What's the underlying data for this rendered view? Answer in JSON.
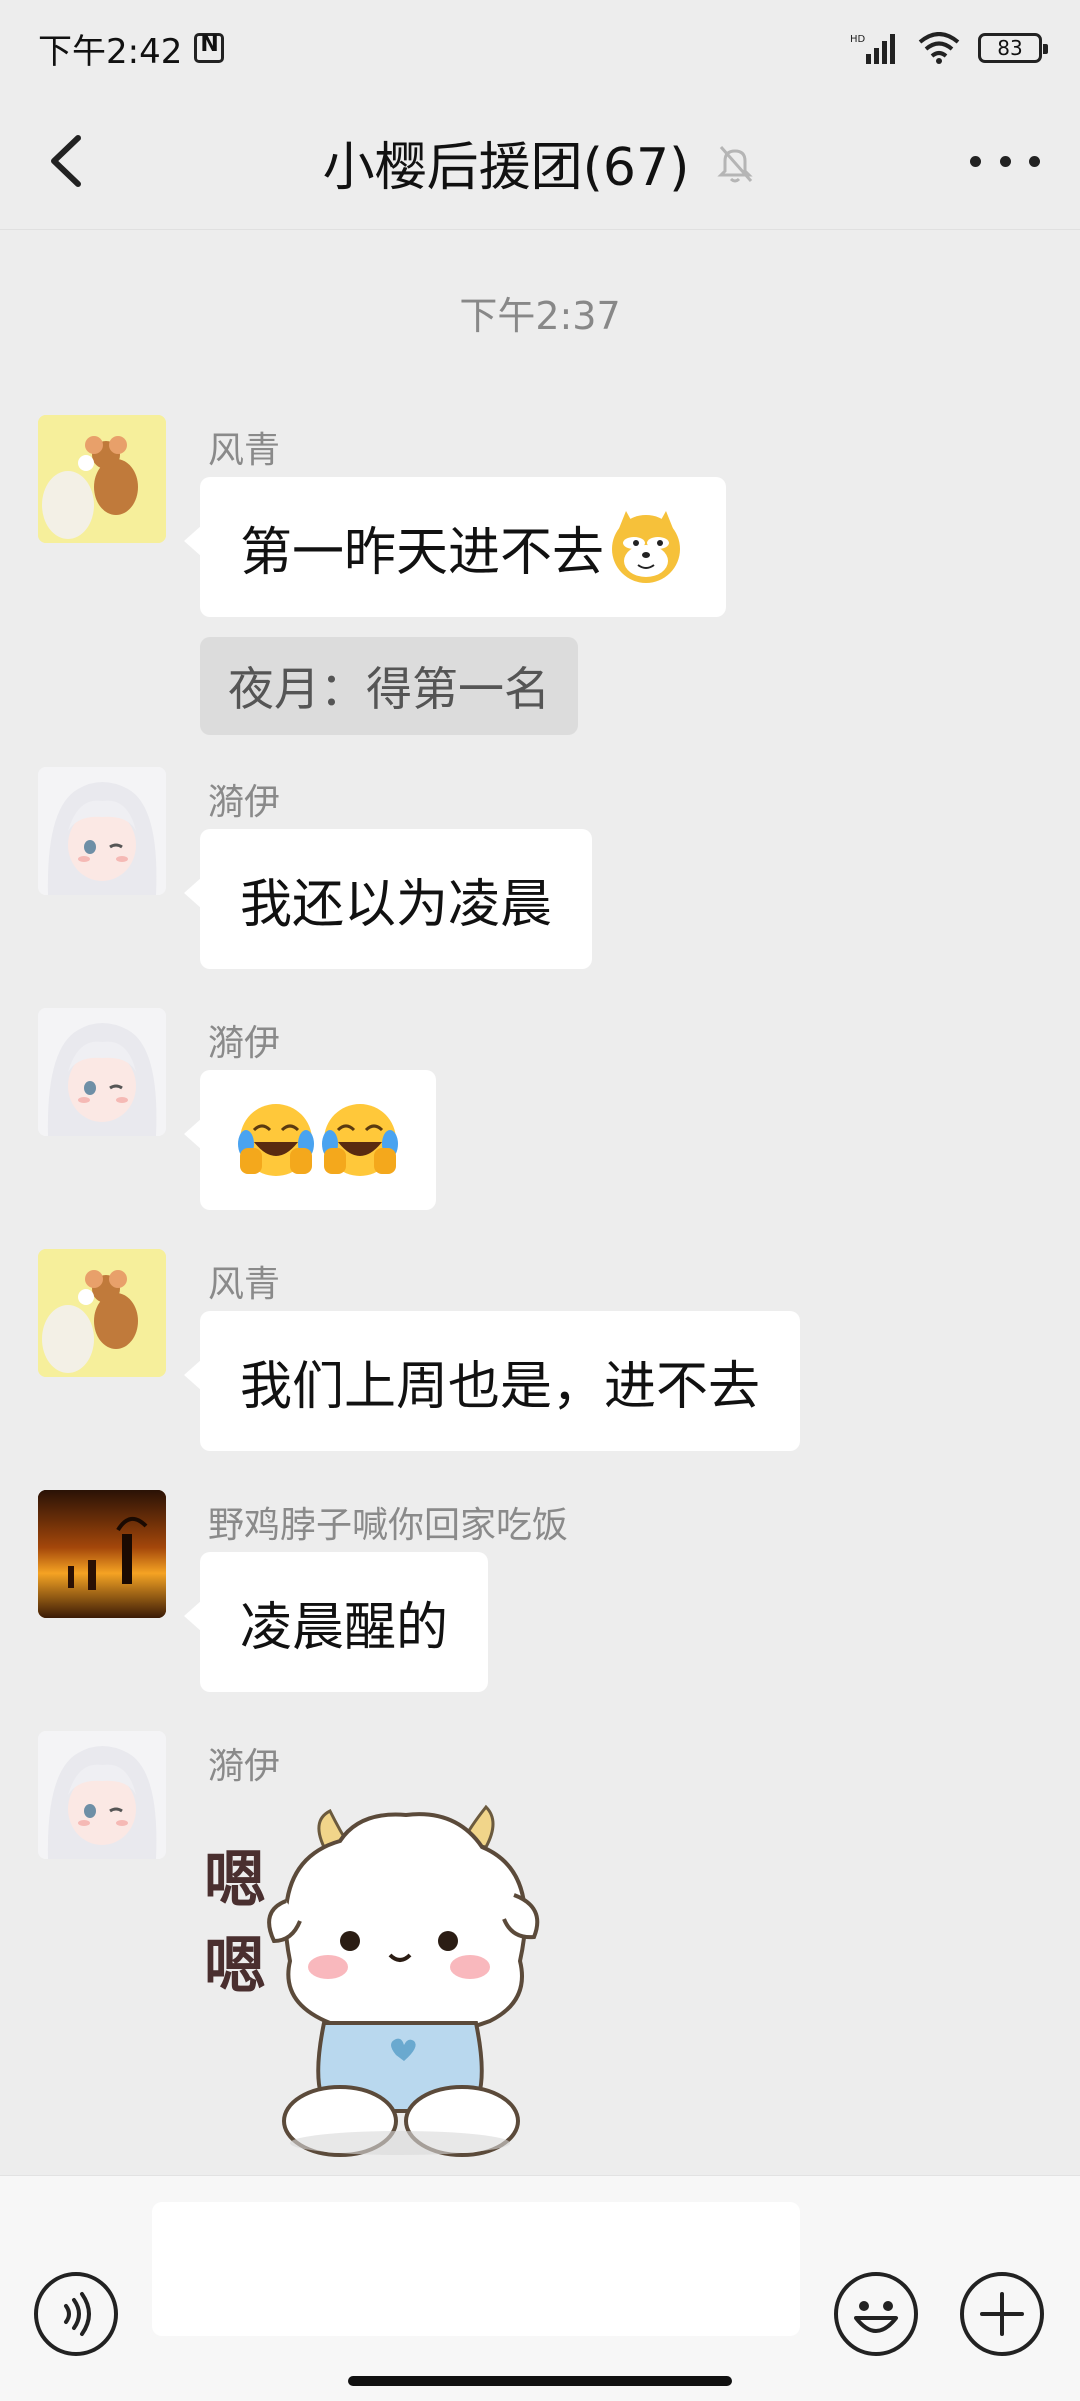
{
  "status_bar": {
    "time": "下午2:42",
    "battery": "83"
  },
  "header": {
    "title": "小樱后援团(67)"
  },
  "chat": {
    "timestamp": "下午2:37",
    "messages": [
      {
        "sender": "风青",
        "text": "第一昨天进不去",
        "quote": "夜月：得第一名",
        "avatar": "cartoon-mouse-avatar",
        "emoji": "doge-emoji"
      },
      {
        "sender": "漪伊",
        "text": "我还以为凌晨",
        "avatar": "anime-girl-avatar"
      },
      {
        "sender": "漪伊",
        "text": "",
        "avatar": "anime-girl-avatar",
        "emoji": "laugh-cry-emoji"
      },
      {
        "sender": "风青",
        "text": "我们上周也是，进不去",
        "avatar": "cartoon-mouse-avatar"
      },
      {
        "sender": "野鸡脖子喊你回家吃饭",
        "text": "凌晨醒的",
        "avatar": "sunset-silhouette-avatar"
      },
      {
        "sender": "漪伊",
        "sticker_text": "嗯嗯",
        "avatar": "anime-girl-avatar",
        "sticker": "white-sheep-sticker"
      }
    ]
  },
  "input_bar": {
    "placeholder": ""
  },
  "colors": {
    "background": "#ededed",
    "bubble": "#ffffff",
    "quote": "#dcdcdc"
  }
}
